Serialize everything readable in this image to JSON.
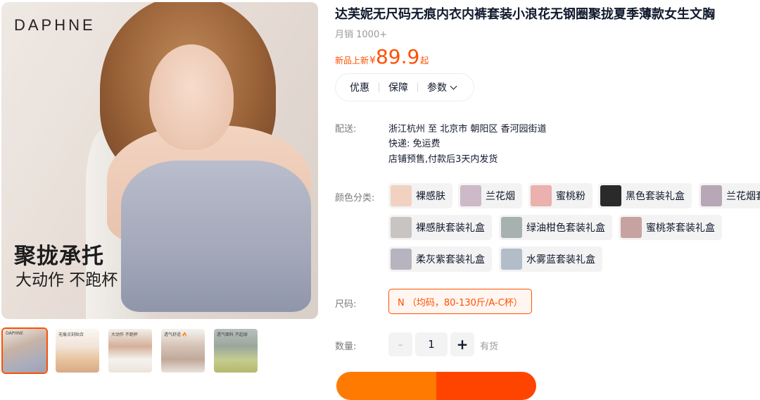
{
  "gallery": {
    "brand": "DAPHNE",
    "slogan_main": "聚拢承托",
    "slogan_sub": "大动作 不跑杯",
    "thumb_caps": [
      "DAPHNE",
      "无痕点刻贴合",
      "大动作 不跑杯",
      "透气舒适 🔥",
      "透气面料 不起球"
    ]
  },
  "product": {
    "title": "达芙妮无尺码无痕内衣内裤套装小浪花无钢圈聚拢夏季薄款女生文胸",
    "sales": "月销 1000+",
    "price_label": "新品上新",
    "currency": "¥",
    "price": "89.9",
    "price_suffix": "起"
  },
  "tabs": {
    "items": [
      "优惠",
      "保障",
      "参数"
    ]
  },
  "shipping": {
    "label": "配送:",
    "route": "浙江杭州 至 北京市 朝阳区 香河园街道",
    "express": "快递: 免运费",
    "presale": "店铺预售,付款后3天内发货"
  },
  "colors": {
    "label": "颜色分类:",
    "options": [
      {
        "name": "裸感肤",
        "swatch": "#f1d2c0"
      },
      {
        "name": "兰花烟",
        "swatch": "#cdb9c7"
      },
      {
        "name": "蜜桃粉",
        "swatch": "#eab1ad"
      },
      {
        "name": "黑色套装礼盒",
        "swatch": "#2a2a2a"
      },
      {
        "name": "兰花烟套",
        "swatch": "#b8a7b7"
      },
      {
        "name": "裸感肤套装礼盒",
        "swatch": "#c8c4c2"
      },
      {
        "name": "绿油柑色套装礼盒",
        "swatch": "#a7b2b0"
      },
      {
        "name": "蜜桃茶套装礼盒",
        "swatch": "#c6a3a1"
      },
      {
        "name": "柔灰紫套装礼盒",
        "swatch": "#b7b4bf"
      },
      {
        "name": "水雾蓝套装礼盒",
        "swatch": "#b3bdc9"
      }
    ]
  },
  "size": {
    "label": "尺码:",
    "option": "N （均码，80-130斤/A-C杯）"
  },
  "quantity": {
    "label": "数量:",
    "minus": "-",
    "value": "1",
    "plus": "+",
    "stock": "有货"
  },
  "theme": {
    "accent": "#ff5000",
    "text": "#11192d",
    "muted": "#9a9a9a"
  }
}
